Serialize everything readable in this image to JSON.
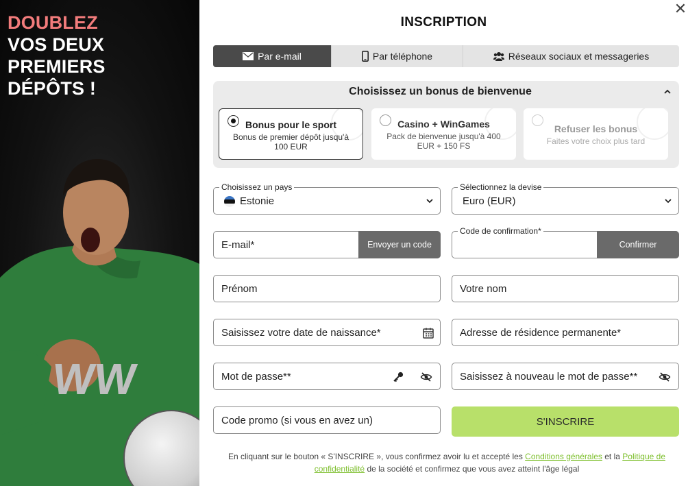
{
  "promo": {
    "line1": "DOUBLEZ",
    "line2": "VOS DEUX",
    "line3": "PREMIERS",
    "line4": "DÉPÔTS !",
    "accent_color": "#f27c7c",
    "jersey_color": "#2f7d3c"
  },
  "modal": {
    "title": "INSCRIPTION",
    "close_icon": "close-icon"
  },
  "tabs": [
    {
      "label": "Par e-mail",
      "icon": "envelope-icon",
      "active": true
    },
    {
      "label": "Par téléphone",
      "icon": "phone-icon",
      "active": false
    },
    {
      "label": "Réseaux sociaux et messageries",
      "icon": "users-icon",
      "active": false
    }
  ],
  "bonus": {
    "heading": "Choisissez un bonus de bienvenue",
    "options": [
      {
        "title": "Bonus pour le sport",
        "subtitle": "Bonus de premier dépôt jusqu'à 100 EUR",
        "selected": true
      },
      {
        "title": "Casino + WinGames",
        "subtitle": "Pack de bienvenue jusqu'à 400 EUR + 150 FS",
        "selected": false
      },
      {
        "title": "Refuser les bonus",
        "subtitle": "Faites votre choix plus tard",
        "selected": false
      }
    ]
  },
  "form": {
    "country_label": "Choisissez un pays",
    "country_value": "Estonie",
    "currency_label": "Sélectionnez la devise",
    "currency_value": "Euro (EUR)",
    "email_placeholder": "E-mail*",
    "send_code_label": "Envoyer un code",
    "confirm_code_label": "Code de confirmation*",
    "confirm_button_label": "Confirmer",
    "first_name_placeholder": "Prénom",
    "last_name_placeholder": "Votre nom",
    "birthdate_placeholder": "Saisissez votre date de naissance*",
    "address_placeholder": "Adresse de résidence permanente*",
    "password_placeholder": "Mot de passe**",
    "password_repeat_placeholder": "Saisissez à nouveau le mot de passe**",
    "promo_placeholder": "Code promo (si vous en avez un)",
    "submit_label": "S'INSCRIRE"
  },
  "legal": {
    "text1": "En cliquant sur le bouton « S'INSCRIRE », vous confirmez avoir lu et accepté les ",
    "link1": "Conditions générales",
    "text2": " et la ",
    "link2": "Politique de confidentialité",
    "text3": " de la société et confirmez que vous avez atteint l'âge légal"
  },
  "colors": {
    "submit_bg": "#b8e06a",
    "link": "#7dbf2c",
    "active_tab": "#4a4a4a"
  }
}
